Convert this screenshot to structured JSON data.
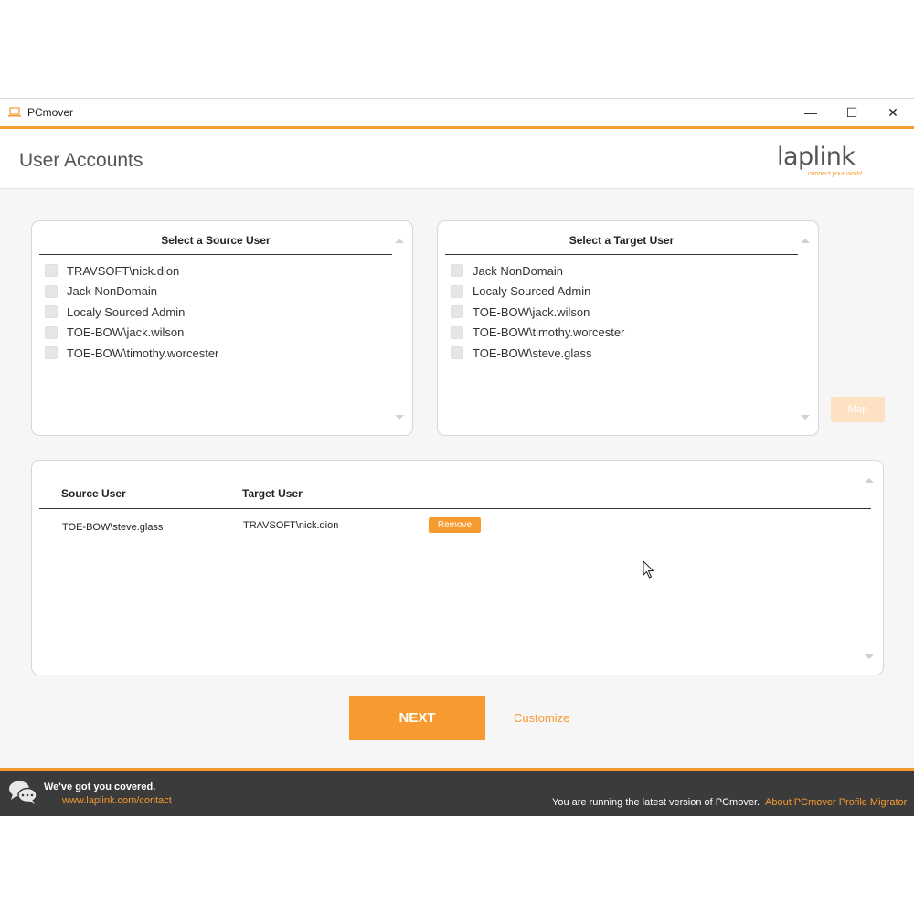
{
  "window": {
    "title": "PCmover",
    "minimize_glyph": "—",
    "maximize_glyph": "☐",
    "close_glyph": "✕"
  },
  "header": {
    "page_title": "User Accounts",
    "logo_text": "laplink",
    "logo_tagline": "connect your world"
  },
  "source_panel": {
    "heading": "Select a Source User",
    "users": [
      {
        "label": "TRAVSOFT\\nick.dion",
        "checked": false
      },
      {
        "label": "Jack NonDomain",
        "checked": false
      },
      {
        "label": "Localy Sourced Admin",
        "checked": false
      },
      {
        "label": "TOE-BOW\\jack.wilson",
        "checked": false
      },
      {
        "label": "TOE-BOW\\timothy.worcester",
        "checked": false
      }
    ]
  },
  "target_panel": {
    "heading": "Select a Target User",
    "users": [
      {
        "label": "Jack NonDomain",
        "checked": false
      },
      {
        "label": "Localy Sourced Admin",
        "checked": false
      },
      {
        "label": "TOE-BOW\\jack.wilson",
        "checked": false
      },
      {
        "label": "TOE-BOW\\timothy.worcester",
        "checked": false
      },
      {
        "label": "TOE-BOW\\steve.glass",
        "checked": false
      }
    ]
  },
  "map_button_label": "Map",
  "mapping_panel": {
    "columns": [
      "Source User",
      "Target User"
    ],
    "rows": [
      {
        "source": "TOE-BOW\\steve.glass",
        "target": "TRAVSOFT\\nick.dion",
        "action": "Remove"
      }
    ]
  },
  "actions": {
    "next_label": "NEXT",
    "customize_label": "Customize"
  },
  "footer": {
    "covered_text": "We've got you covered.",
    "contact_link": "www.laplink.com/contact",
    "version_text": "You are running the latest version of PCmover.",
    "about_link": "About PCmover Profile Migrator"
  },
  "colors": {
    "accent": "#f79a30",
    "footer_bg": "#3b3b3b",
    "map_disabled": "#fde1c2"
  },
  "icons": {
    "app": "laptop-icon",
    "footer": "chat-bubbles-icon",
    "cursor": "mouse-pointer-icon"
  }
}
